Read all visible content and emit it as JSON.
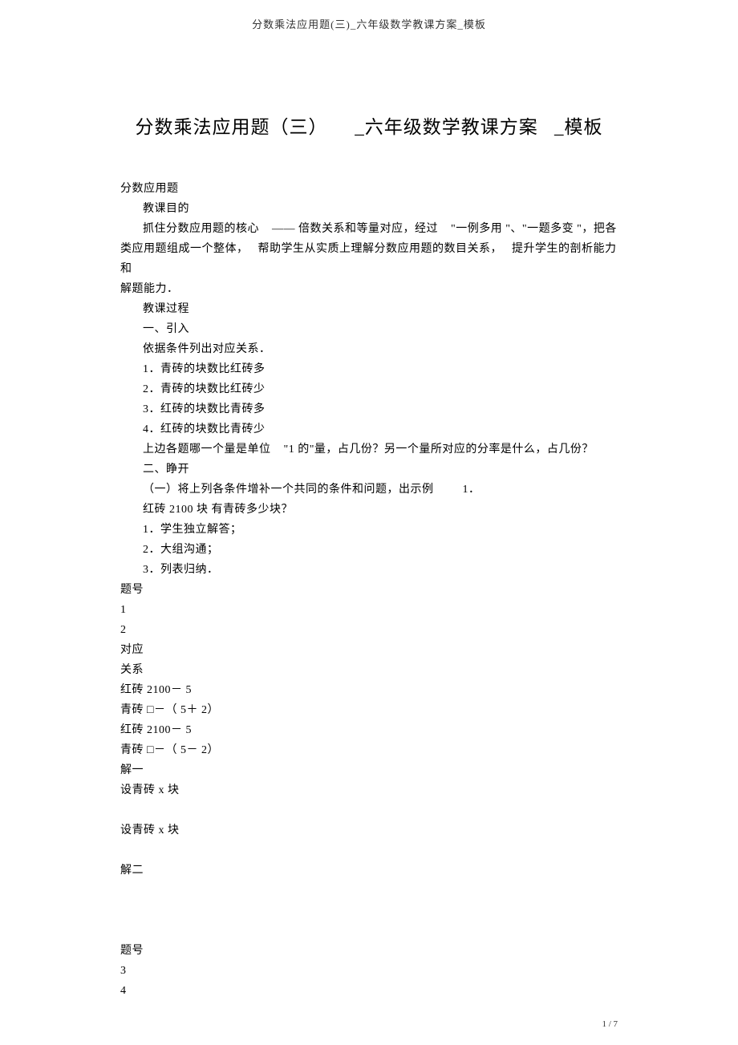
{
  "header": "分数乘法应用题(三)_六年级数学教课方案_模板",
  "title_fragments": {
    "p1": "分数乘法应用题（三）",
    "p2": "_六年级数学教课方案",
    "p3": "_模板"
  },
  "body": {
    "l1": "分数应用题",
    "l2": "教课目的",
    "l3a": "抓住分数应用题的核心",
    "l3b": "—— 倍数关系和等量对应，经过",
    "l3c": "\"一例多用 \"、\"一题多变 \"，把各",
    "l4a": "类应用题组成一个整体，",
    "l4b": "帮助学生从实质上理解分数应用题的数目关系，",
    "l4c": "提升学生的剖析能力和",
    "l5": "解题能力．",
    "l6": "教课过程",
    "l7": "一、引入",
    "l8": "依据条件列出对应关系．",
    "l9": "1．青砖的块数比红砖多",
    "l10": "2．青砖的块数比红砖少",
    "l11": "3．红砖的块数比青砖多",
    "l12": "4．红砖的块数比青砖少",
    "l13a": "上边各题哪一个量是单位",
    "l13b": "\"1 的\"量，占几份？另一个量所对应的分率是什么，占几份？",
    "l14": "二、睁开",
    "l15a": "（一）将上列各条件增补一个共同的条件和问题，出示例",
    "l15b": "1．",
    "l16": "红砖 2100 块  有青砖多少块？",
    "l17": "1．学生独立解答；",
    "l18": "2．大组沟通；",
    "l19": "3．列表归纳．",
    "l20": "题号",
    "l21": "1",
    "l22": "2",
    "l23": "对应",
    "l24": "关系",
    "l25": "红砖 2100－ 5",
    "l26": "青砖 □－（ 5＋ 2）",
    "l27": "红砖 2100－ 5",
    "l28": "青砖 □－（ 5－ 2）",
    "l29": "解一",
    "l30": "设青砖 x 块",
    "l31": "设青砖 x 块",
    "l32": "解二",
    "l33": "题号",
    "l34": "3",
    "l35": "4"
  },
  "footer": "1 / 7"
}
